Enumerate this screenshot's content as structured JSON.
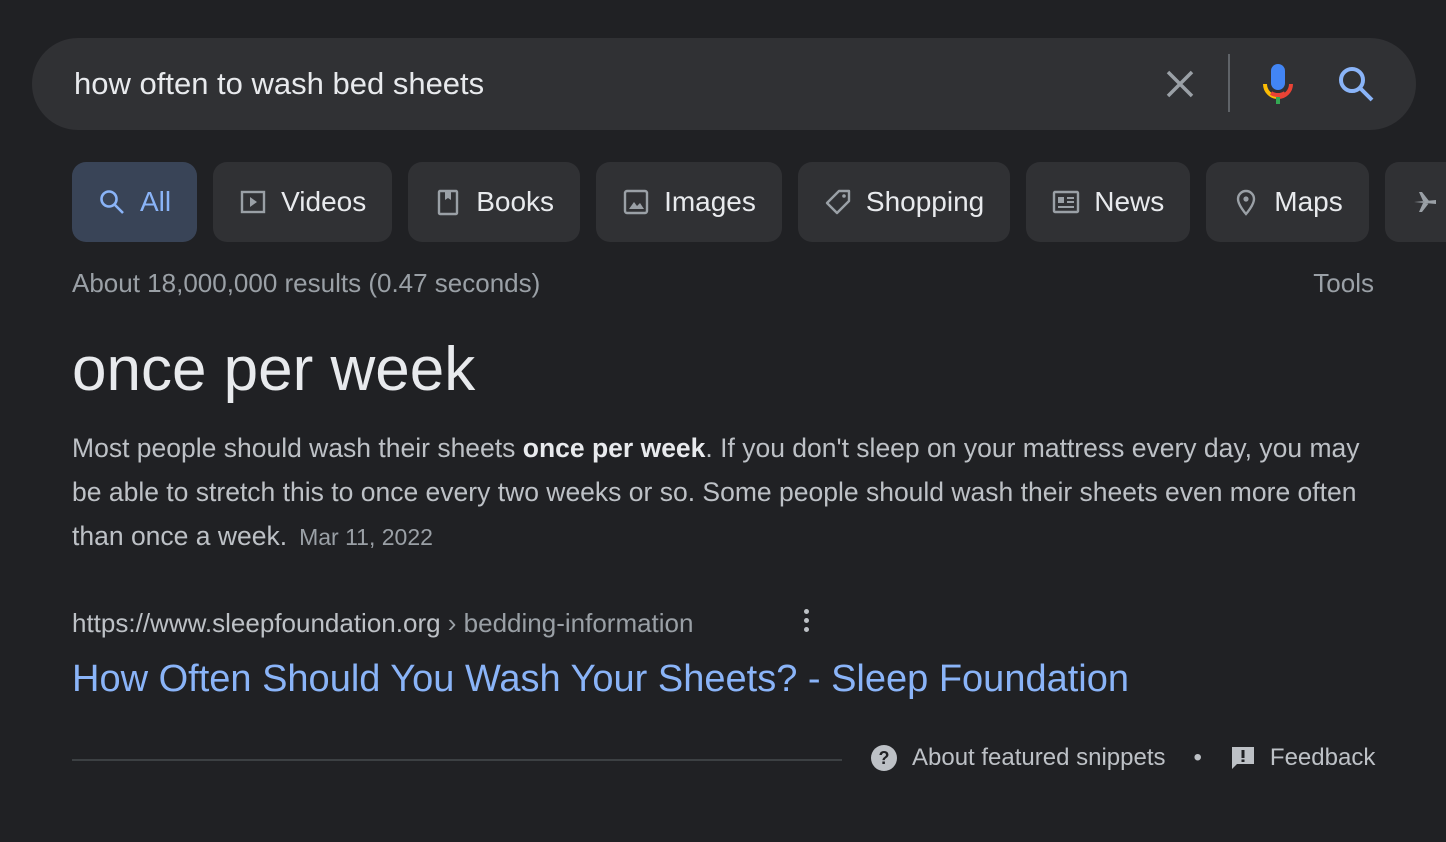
{
  "search": {
    "query": "how often to wash bed sheets",
    "colors": {
      "mic_blue": "#4285f4",
      "mic_red": "#ea4335",
      "mic_yellow": "#fbbc04",
      "mic_green": "#34a853",
      "search_icon": "#8ab4f8"
    }
  },
  "tabs": [
    {
      "label": "All",
      "icon": "search-icon",
      "active": true
    },
    {
      "label": "Videos",
      "icon": "play-icon"
    },
    {
      "label": "Books",
      "icon": "book-icon"
    },
    {
      "label": "Images",
      "icon": "image-icon"
    },
    {
      "label": "Shopping",
      "icon": "tag-icon"
    },
    {
      "label": "News",
      "icon": "newspaper-icon"
    },
    {
      "label": "Maps",
      "icon": "map-pin-icon"
    },
    {
      "label": "",
      "icon": "airplane-icon"
    }
  ],
  "results": {
    "stats": "About 18,000,000 results (0.47 seconds)",
    "tools": "Tools"
  },
  "snippet": {
    "answer": "once per week",
    "text_before": "Most people should wash their sheets ",
    "text_bold": "once per week",
    "text_after": ". If you don't sleep on your mattress every day, you may be able to stretch this to once every two weeks or so. Some people should wash their sheets even more often than once a week.",
    "date": "Mar 11, 2022",
    "url_domain": "https://www.sleepfoundation.org",
    "url_path": " › bedding-information",
    "title": "How Often Should You Wash Your Sheets? - Sleep Foundation"
  },
  "footer": {
    "about": "About featured snippets",
    "separator": "•",
    "feedback": "Feedback"
  }
}
